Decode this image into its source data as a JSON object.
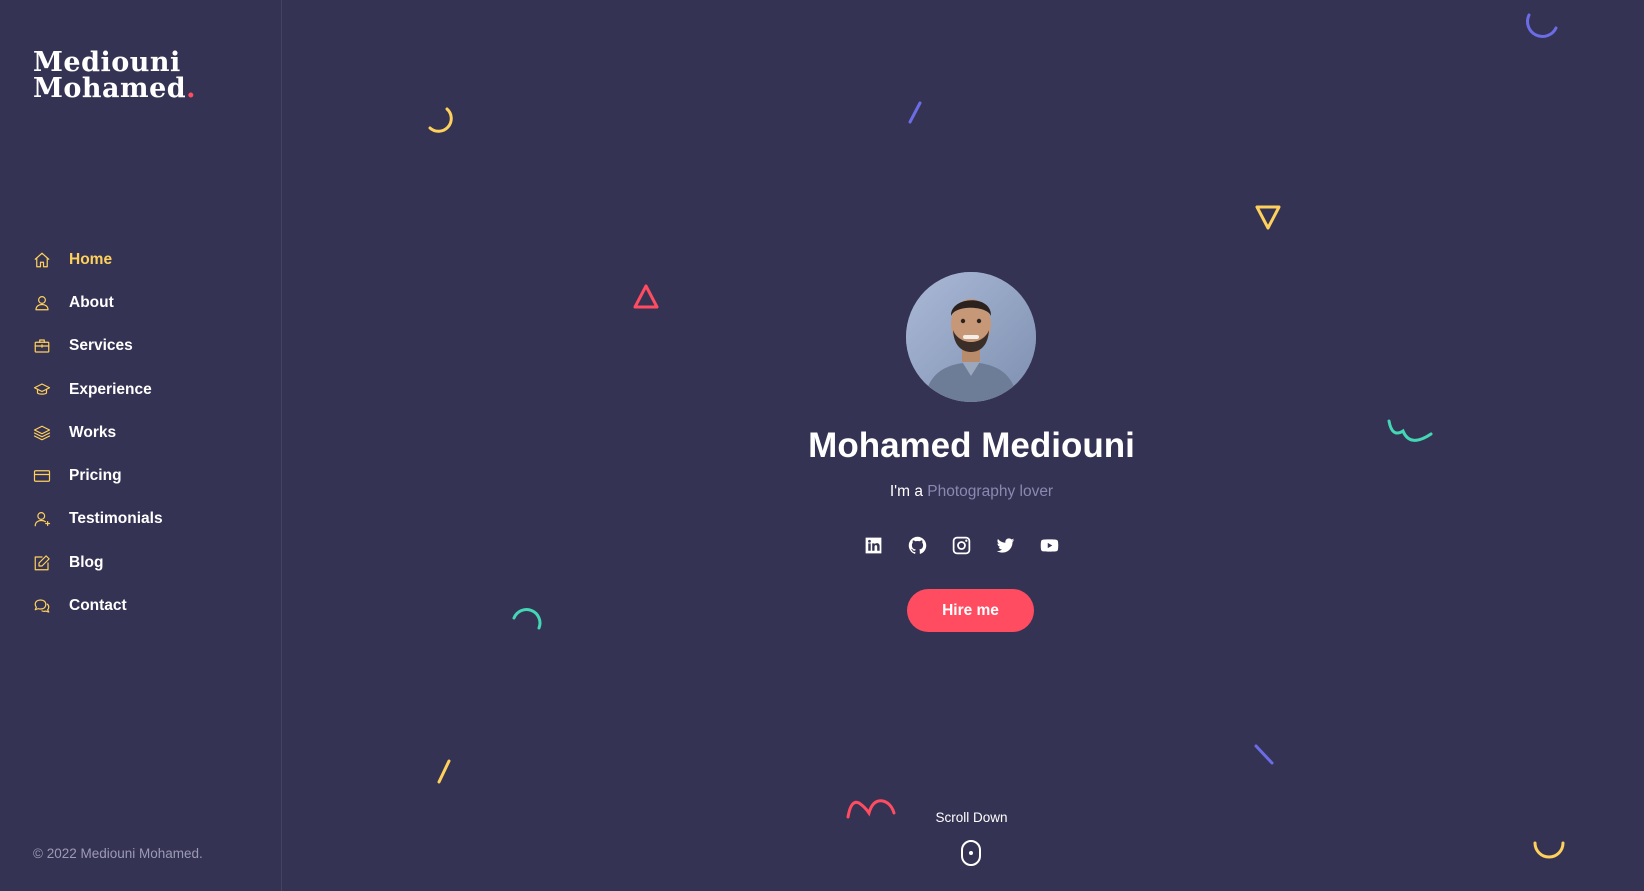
{
  "brand": {
    "line1": "Mediouni",
    "line2": "Mohamed",
    "dot": ".",
    "dot_color": "#ff4c60"
  },
  "nav": {
    "items": [
      {
        "label": "Home",
        "icon": "home-icon",
        "active": true
      },
      {
        "label": "About",
        "icon": "user-icon",
        "active": false
      },
      {
        "label": "Services",
        "icon": "briefcase-icon",
        "active": false
      },
      {
        "label": "Experience",
        "icon": "graduation-cap-icon",
        "active": false
      },
      {
        "label": "Works",
        "icon": "layers-icon",
        "active": false
      },
      {
        "label": "Pricing",
        "icon": "credit-card-icon",
        "active": false
      },
      {
        "label": "Testimonials",
        "icon": "user-voice-icon",
        "active": false
      },
      {
        "label": "Blog",
        "icon": "edit-icon",
        "active": false
      },
      {
        "label": "Contact",
        "icon": "chat-icon",
        "active": false
      }
    ]
  },
  "footer": {
    "copyright": "© 2022 Mediouni Mohamed."
  },
  "hero": {
    "name": "Mohamed Mediouni",
    "tagline_prefix": "I'm a ",
    "tagline_typed": "Photography lover",
    "socials": [
      "linkedin-icon",
      "github-icon",
      "instagram-icon",
      "twitter-icon",
      "youtube-icon"
    ],
    "cta": "Hire me",
    "scroll_label": "Scroll Down"
  },
  "colors": {
    "background": "#353353",
    "accent_yellow": "#ffd15c",
    "accent_red": "#ff4c60",
    "accent_purple": "#6c6ce5",
    "accent_teal": "#44d7b6"
  }
}
